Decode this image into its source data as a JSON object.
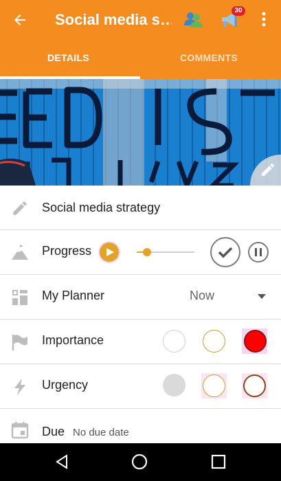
{
  "appbar": {
    "title": "Social media s…",
    "notification_count": "30",
    "background": "#F58C1F"
  },
  "tabs": [
    {
      "label": "DETAILS",
      "selected": true
    },
    {
      "label": "COMMENTS",
      "selected": false
    }
  ],
  "fields": {
    "name": "Social media strategy",
    "progress": {
      "label": "Progress",
      "value": 0.1
    },
    "planner": {
      "label": "My Planner",
      "selected": "Now"
    },
    "importance": {
      "label": "Importance",
      "selected_level": 3
    },
    "urgency": {
      "label": "Urgency",
      "selected_level": 1
    },
    "due": {
      "label": "Due",
      "value": "No due date"
    }
  },
  "icons": {
    "back": "arrow-left-icon",
    "people": "people-icon",
    "megaphone": "megaphone-icon",
    "more": "kebab-menu-icon",
    "edit_cover": "pencil-icon",
    "name": "pencil-icon",
    "progress": "mountain-icon",
    "planner": "planner-icon",
    "importance": "flag-icon",
    "urgency": "lightning-icon",
    "due": "calendar-icon"
  },
  "colors": {
    "accent": "#E3A22A",
    "importance_selected": "#FF0000",
    "urgency_selected_ring": "#8B4513"
  }
}
